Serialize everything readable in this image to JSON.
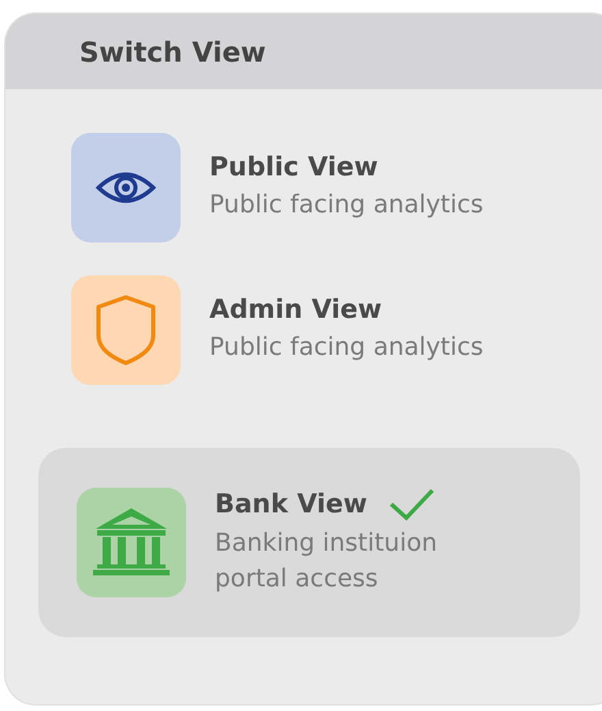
{
  "panel": {
    "title": "Switch View"
  },
  "views": [
    {
      "kind": "public",
      "title": "Public View",
      "subtitle": "Public facing analytics",
      "selected": false
    },
    {
      "kind": "admin",
      "title": "Admin View",
      "subtitle": "Public facing analytics",
      "selected": false
    },
    {
      "kind": "bank",
      "title": "Bank View",
      "subtitle": "Banking instituion portal access",
      "selected": true
    }
  ]
}
